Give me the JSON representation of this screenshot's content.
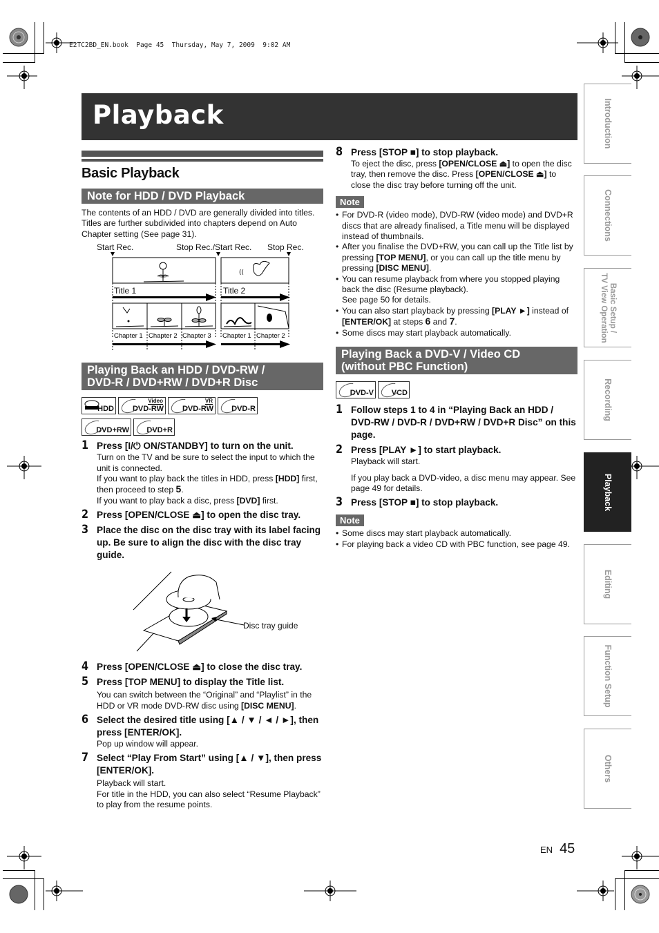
{
  "print_header": "E2TC2BD_EN.book  Page 45  Thursday, May 7, 2009  9:02 AM",
  "page_title": "Playback",
  "section_title": "Basic Playback",
  "note_hdd_dvd": {
    "heading": "Note for HDD / DVD Playback",
    "body": "The contents of an HDD / DVD are generally divided into titles. Titles are further subdivided into chapters depend on Auto Chapter setting (See page 31).",
    "diagram": {
      "markers": [
        "Start Rec.",
        "Stop Rec./Start Rec.",
        "Stop Rec."
      ],
      "titles": [
        "Title 1",
        "Title 2"
      ],
      "title1_chapters": [
        "Chapter 1",
        "Chapter 2",
        "Chapter 3"
      ],
      "title2_chapters": [
        "Chapter 1",
        "Chapter 2"
      ]
    }
  },
  "hdd_section": {
    "heading_line1": "Playing Back an HDD / DVD-RW /",
    "heading_line2": "DVD-R / DVD+RW / DVD+R Disc",
    "disc_icons": [
      {
        "label": "HDD",
        "sup": ""
      },
      {
        "label": "DVD-RW",
        "sup": "Video"
      },
      {
        "label": "DVD-RW",
        "sup": "VR"
      },
      {
        "label": "DVD-R",
        "sup": ""
      },
      {
        "label": "DVD+RW",
        "sup": ""
      },
      {
        "label": "DVD+R",
        "sup": ""
      }
    ],
    "steps": [
      {
        "num": "1",
        "head": "Press [I/⏻ ON/STANDBY] to turn on the unit.",
        "body_1": "Turn on the TV and be sure to select the input to which the unit is connected.",
        "body_2a": "If you want to play back the titles in HDD, press ",
        "body_2b": "[HDD]",
        "body_2c": " first, then proceed to step ",
        "body_2d": "5",
        "body_2e": ".",
        "body_3a": "If you want to play back a disc, press ",
        "body_3b": "[DVD]",
        "body_3c": " first."
      },
      {
        "num": "2",
        "head": "Press [OPEN/CLOSE ⏏] to open the disc tray."
      },
      {
        "num": "3",
        "head": "Place the disc on the disc tray with its label facing up. Be sure to align the disc with the disc tray guide."
      },
      {
        "num": "4",
        "head": "Press [OPEN/CLOSE ⏏] to close the disc tray."
      },
      {
        "num": "5",
        "head": "Press [TOP MENU] to display the Title list.",
        "body_a": "You can switch between the “Original” and “Playlist” in the HDD or VR mode DVD-RW disc using ",
        "body_b": "[DISC MENU]",
        "body_c": "."
      },
      {
        "num": "6",
        "head": "Select the desired title using [▲ / ▼ / ◄ / ►], then press [ENTER/OK].",
        "body": "Pop up window will appear."
      },
      {
        "num": "7",
        "head": "Select “Play From Start” using [▲ / ▼], then press [ENTER/OK].",
        "body_1": "Playback will start.",
        "body_2": "For title in the HDD, you can also select “Resume Playback” to play from the resume points."
      },
      {
        "num": "8",
        "head": "Press [STOP ■] to stop playback.",
        "body_a": "To eject the disc, press ",
        "body_b": "[OPEN/CLOSE ⏏]",
        "body_c": " to open the disc tray, then remove the disc. Press ",
        "body_d": "[OPEN/CLOSE ⏏]",
        "body_e": " to close the disc tray before turning off the unit."
      }
    ],
    "illustration_label": "Disc tray guide",
    "note_label": "Note",
    "notes": [
      {
        "t": "For DVD-R (video mode), DVD-RW (video mode) and DVD+R discs that are already finalised, a Title menu will be displayed instead of thumbnails."
      },
      {
        "a": "After you finalise the DVD+RW, you can call up the Title list by pressing ",
        "b": "[TOP MENU]",
        "c": ", or you can call up the title menu by pressing ",
        "d": "[DISC MENU]",
        "e": "."
      },
      {
        "t": "You can resume playback from where you stopped playing back the disc (Resume playback).",
        "t2": "See page 50 for details."
      },
      {
        "a": "You can also start playback by pressing ",
        "b": "[PLAY ►]",
        "c": " instead of ",
        "d": "[ENTER/OK]",
        "e": " at steps ",
        "f": "6",
        "g": " and ",
        "h": "7",
        "i": "."
      },
      {
        "t": "Some discs may start playback automatically."
      }
    ]
  },
  "dvdv_section": {
    "heading_line1": "Playing Back a DVD-V / Video CD",
    "heading_line2": "(without PBC Function)",
    "disc_icons": [
      {
        "label": "DVD-V"
      },
      {
        "label": "VCD"
      }
    ],
    "steps": [
      {
        "num": "1",
        "head": "Follow steps 1 to 4 in “Playing Back an HDD / DVD-RW / DVD-R / DVD+RW / DVD+R Disc” on this page."
      },
      {
        "num": "2",
        "head": "Press [PLAY ►] to start playback.",
        "body_1": "Playback will start.",
        "body_2": "If you play back a DVD-video, a disc menu may appear. See page 49 for details."
      },
      {
        "num": "3",
        "head": "Press [STOP ■] to stop playback."
      }
    ],
    "note_label": "Note",
    "notes": [
      "Some discs may start playback automatically.",
      "For playing back a video CD with PBC function, see page 49."
    ]
  },
  "side_tabs": [
    {
      "label": "Introduction",
      "active": false
    },
    {
      "label": "Connections",
      "active": false
    },
    {
      "label": "Basic Setup /",
      "label2": "TV View Operation",
      "active": false
    },
    {
      "label": "Recording",
      "active": false
    },
    {
      "label": "Playback",
      "active": true
    },
    {
      "label": "Editing",
      "active": false
    },
    {
      "label": "Function Setup",
      "active": false
    },
    {
      "label": "Others",
      "active": false
    }
  ],
  "footer": {
    "lang": "EN",
    "page": "45"
  }
}
